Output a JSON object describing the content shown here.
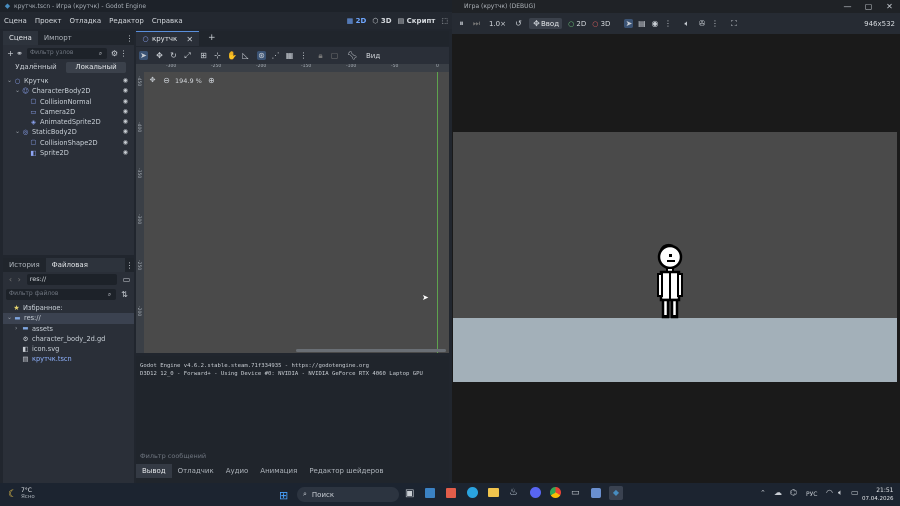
{
  "godot": {
    "title": "крутчк.tscn - Игра (крутчк) - Godot Engine",
    "menu": [
      "Сцена",
      "Проект",
      "Отладка",
      "Редактор",
      "Справка"
    ],
    "modes": {
      "d2": "2D",
      "d3": "3D",
      "script": "Скрипт"
    },
    "scene_dock": {
      "tabs": [
        "Сцена",
        "Импорт"
      ],
      "filter_placeholder": "Фильтр узлов",
      "remote": "Удалённый",
      "local": "Локальный",
      "nodes": [
        {
          "label": "Крутчк",
          "depth": 0,
          "icon": "node2d-icon",
          "color": "#8da5f3"
        },
        {
          "label": "CharacterBody2D",
          "depth": 1,
          "icon": "character-icon",
          "color": "#8da5f3"
        },
        {
          "label": "CollisionNormal",
          "depth": 2,
          "icon": "collision-icon",
          "color": "#8da5f3"
        },
        {
          "label": "Camera2D",
          "depth": 2,
          "icon": "camera-icon",
          "color": "#8da5f3"
        },
        {
          "label": "AnimatedSprite2D",
          "depth": 2,
          "icon": "animsprite-icon",
          "color": "#8da5f3"
        },
        {
          "label": "StaticBody2D",
          "depth": 1,
          "icon": "static-icon",
          "color": "#8da5f3"
        },
        {
          "label": "CollisionShape2D",
          "depth": 2,
          "icon": "collision-icon",
          "color": "#8da5f3"
        },
        {
          "label": "Sprite2D",
          "depth": 2,
          "icon": "sprite-icon",
          "color": "#8da5f3"
        }
      ]
    },
    "fs_dock": {
      "tabs": [
        "История",
        "Файловая система"
      ],
      "path": "res://",
      "filter_placeholder": "Фильтр файлов",
      "favorites": "Избранное:",
      "items": [
        {
          "label": "res://",
          "depth": 0,
          "icon": "folder-icon"
        },
        {
          "label": "assets",
          "depth": 1,
          "icon": "folder-icon"
        },
        {
          "label": "character_body_2d.gd",
          "depth": 1,
          "icon": "gear-icon"
        },
        {
          "label": "icon.svg",
          "depth": 1,
          "icon": "image-icon"
        },
        {
          "label": "крутчк.tscn",
          "depth": 1,
          "icon": "scene-icon"
        }
      ]
    },
    "editor_tab": "крутчк",
    "view_label": "Вид",
    "zoom": "194.9 %",
    "ruler_marks": [
      "-300",
      "-250",
      "-200",
      "-150",
      "-100",
      "-50",
      "0"
    ],
    "ruler_v": [
      "-450",
      "-400",
      "-350",
      "-300",
      "-250",
      "-200"
    ],
    "output": {
      "lines": [
        "Godot Engine v4.6.2.stable.steam.71f334935 - https://godotengine.org",
        "D3D12 12_0 - Forward+ - Using Device #0: NVIDIA - NVIDIA GeForce RTX 4060 Laptop GPU"
      ],
      "filter_placeholder": "Фильтр сообщений",
      "tabs": [
        "Вывод",
        "Отладчик",
        "Аудио",
        "Анимация",
        "Редактор шейдеров"
      ]
    }
  },
  "game": {
    "title": "Игра (крутчк) (DEBUG)",
    "speed": "1.0×",
    "input_label": "Ввод",
    "d2": "2D",
    "d3": "3D",
    "resolution": "946x532"
  },
  "taskbar": {
    "weather_temp": "7°C",
    "weather_desc": "Ясно",
    "search": "Поиск",
    "lang": "РУС",
    "time": "21:51",
    "date": "07.04.2026"
  }
}
